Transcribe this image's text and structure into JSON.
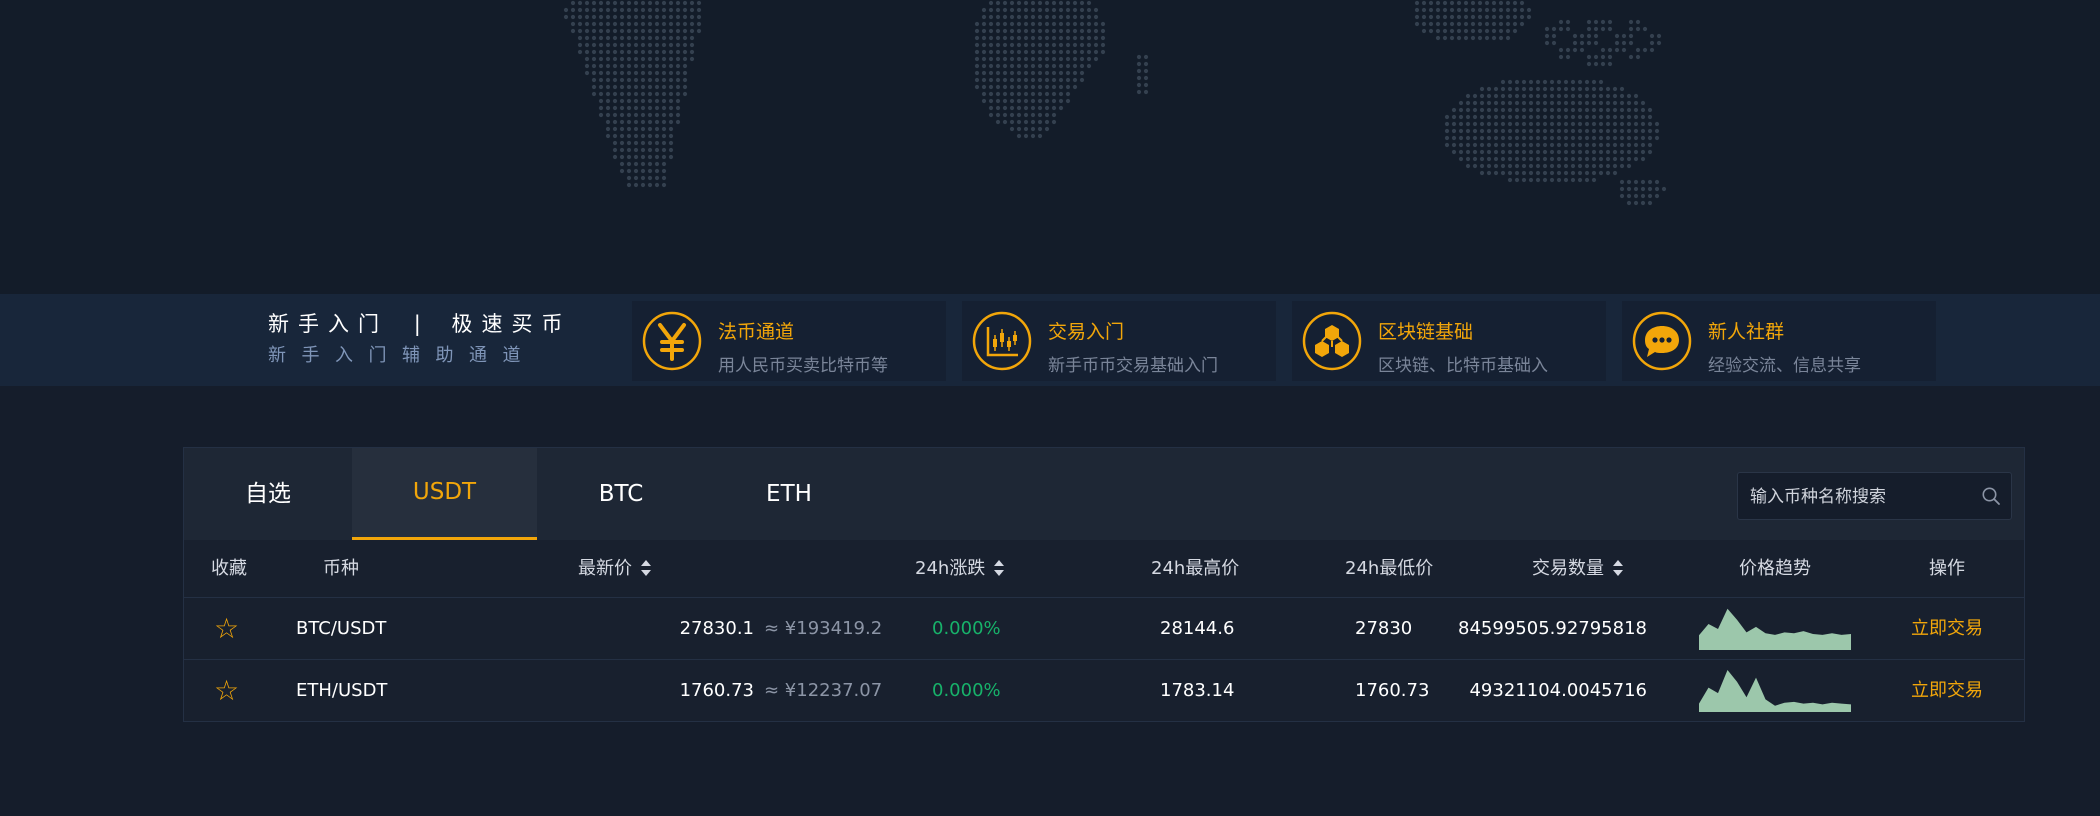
{
  "guide": {
    "title_left": "新手入门",
    "divider": "|",
    "title_right": "极速买币",
    "subtitle": "新手入门辅助通道",
    "cards": [
      {
        "icon": "yuan-icon",
        "title": "法币通道",
        "desc": "用人民币买卖比特币等"
      },
      {
        "icon": "candlestick-chart-icon",
        "title": "交易入门",
        "desc": "新手币币交易基础入门"
      },
      {
        "icon": "blockchain-cubes-icon",
        "title": "区块链基础",
        "desc": "区块链、比特币基础入"
      },
      {
        "icon": "chat-bubble-icon",
        "title": "新人社群",
        "desc": "经验交流、信息共享"
      }
    ]
  },
  "market": {
    "tabs": [
      "自选",
      "USDT",
      "BTC",
      "ETH"
    ],
    "active_tab": "USDT",
    "search": {
      "placeholder": "输入币种名称搜索"
    },
    "columns": [
      "收藏",
      "币种",
      "最新价",
      "24h涨跌",
      "24h最高价",
      "24h最低价",
      "交易数量",
      "价格趋势",
      "操作"
    ],
    "rows": [
      {
        "fav": "☆",
        "pair": "BTC/USDT",
        "price": "27830.1",
        "cny": "≈ ¥193419.2",
        "change": "0.000%",
        "high": "28144.6",
        "low": "27830",
        "volume": "84599505.92795818",
        "trend": [
          0.35,
          0.62,
          0.5,
          0.98,
          0.72,
          0.42,
          0.55,
          0.4,
          0.36,
          0.42,
          0.4,
          0.45,
          0.38,
          0.36,
          0.4,
          0.36,
          0.38
        ],
        "action": "立即交易"
      },
      {
        "fav": "☆",
        "pair": "ETH/USDT",
        "price": "1760.73",
        "cny": "≈ ¥12237.07",
        "change": "0.000%",
        "high": "1783.14",
        "low": "1760.73",
        "volume": "49321104.0045716",
        "trend": [
          0.2,
          0.58,
          0.45,
          1.0,
          0.72,
          0.35,
          0.82,
          0.3,
          0.15,
          0.22,
          0.24,
          0.2,
          0.22,
          0.18,
          0.22,
          0.2,
          0.18
        ],
        "action": "立即交易"
      }
    ]
  },
  "colors": {
    "accent": "#f2a60a",
    "up": "#17b26a",
    "spark_fill": "#9cc7ab",
    "bg": "#151d2b"
  }
}
